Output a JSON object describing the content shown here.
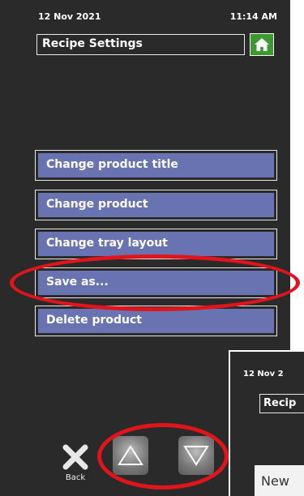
{
  "status": {
    "date": "12 Nov 2021",
    "time": "11:14 AM"
  },
  "header": {
    "title": "Recipe Settings",
    "home_icon": "home-icon"
  },
  "menu": {
    "items": [
      {
        "label": "Change product title"
      },
      {
        "label": "Change product"
      },
      {
        "label": "Change tray layout"
      },
      {
        "label": "Save as..."
      },
      {
        "label": "Delete product"
      }
    ]
  },
  "footer": {
    "back_label": "Back",
    "back_icon": "close-icon",
    "up_icon": "up-arrow-icon",
    "down_icon": "down-arrow-icon"
  },
  "overlay_screen": {
    "date": "12 Nov 2",
    "title": "Recip",
    "input_value": "New"
  },
  "colors": {
    "button_fill": "#6a73b2",
    "highlight": "#e2141b",
    "home": "#3a9a2f",
    "background": "#2a2a2a"
  }
}
